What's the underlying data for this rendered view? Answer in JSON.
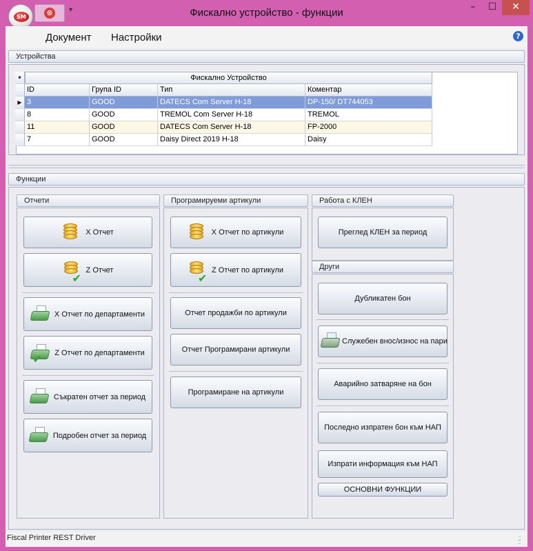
{
  "window": {
    "title": "Фискално устройство - функции",
    "logo_text": "SM",
    "min_glyph": "–",
    "max_glyph": "☐",
    "close_glyph": "✕",
    "qat_glyph": "⊗",
    "qat_dropdown_glyph": "▾"
  },
  "menu": {
    "items": [
      "Документ",
      "Настройки"
    ],
    "help_glyph": "?"
  },
  "devices": {
    "header": "Устройства",
    "grid": {
      "band_title": "Фискално Устройство",
      "corner_glyph": "⁕",
      "columns": [
        "ID",
        "Група ID",
        "Тип",
        "Коментар"
      ],
      "rows": [
        {
          "id": "3",
          "group": "GOOD",
          "type": "DATECS Com Server H-18",
          "comment": "DP-150/ DT744053",
          "selected": true
        },
        {
          "id": "8",
          "group": "GOOD",
          "type": "TREMOL Com Server H-18",
          "comment": "TREMOL",
          "selected": false
        },
        {
          "id": "11",
          "group": "GOOD",
          "type": "DATECS Com Server H-18",
          "comment": "FP-2000",
          "selected": false
        },
        {
          "id": "7",
          "group": "GOOD",
          "type": "Daisy Direct 2019 H-18",
          "comment": "Daisy",
          "selected": false
        }
      ],
      "row_pointer_glyph": "▶"
    }
  },
  "functions": {
    "header": "Функции",
    "reports": {
      "header": "Отчети",
      "buttons": [
        {
          "label": "X Отчет",
          "icon": "coins-icon"
        },
        {
          "label": "Z Отчет",
          "icon": "coins-check-icon"
        },
        {
          "label": "X Отчет по департаменти",
          "icon": "printer-icon"
        },
        {
          "label": "Z Отчет по департаменти",
          "icon": "printer-check-icon"
        },
        {
          "label": "Съкратен отчет за период",
          "icon": "printer-icon"
        },
        {
          "label": "Подробен отчет за период",
          "icon": "printer-icon"
        }
      ]
    },
    "articles": {
      "header": "Програмируеми артикули",
      "buttons": [
        {
          "label": "X Отчет по артикули",
          "icon": "coins-icon"
        },
        {
          "label": "Z Отчет по артикули",
          "icon": "coins-check-icon"
        },
        {
          "label": "Отчет продажби по артикули"
        },
        {
          "label": "Отчет Програмирани артикули"
        },
        {
          "label": "Програмиране на артикули"
        }
      ]
    },
    "klen": {
      "header": "Работа с КЛЕН",
      "buttons": [
        {
          "label": "Преглед КЛЕН за период"
        }
      ]
    },
    "other": {
      "header": "Други",
      "buttons": [
        {
          "label": "Дубликатен бон"
        },
        {
          "label": "Служебен внос/износ на пари",
          "icon": "cash-register-icon"
        },
        {
          "label": "Аварийно затваряне на бон"
        },
        {
          "label": "Последно изпратен бон към НАП"
        },
        {
          "label": "Изпрати информация към НАП"
        },
        {
          "label": "ОСНОВНИ ФУНКЦИИ"
        }
      ]
    }
  },
  "status": {
    "text": "Fiscal Printer REST Driver"
  },
  "colors": {
    "window_frame": "#d35fb0",
    "selected_row": "#7f9bd9",
    "close_button": "#c75050"
  }
}
